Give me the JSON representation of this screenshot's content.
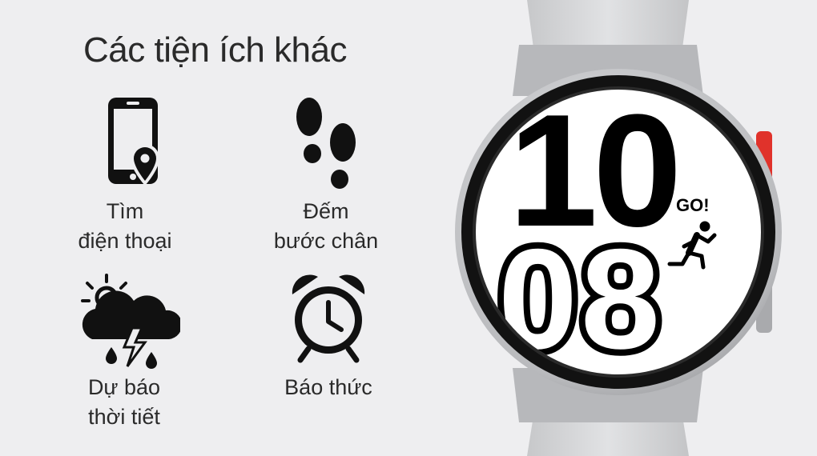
{
  "title": "Các tiện ích khác",
  "features": [
    {
      "icon": "phone-location-icon",
      "label": "Tìm\nđiện thoại"
    },
    {
      "icon": "footsteps-icon",
      "label": "Đếm\nbước chân"
    },
    {
      "icon": "weather-storm-icon",
      "label": "Dự báo\nthời tiết"
    },
    {
      "icon": "alarm-clock-icon",
      "label": "Báo thức"
    }
  ],
  "watch": {
    "hour": "10",
    "minute": "08",
    "badge": "GO!",
    "colors": {
      "case": "#c9cacc",
      "strap": "#d7d8da",
      "bezel": "#121212",
      "face": "#ffffff",
      "accent": "#e0322b"
    }
  }
}
